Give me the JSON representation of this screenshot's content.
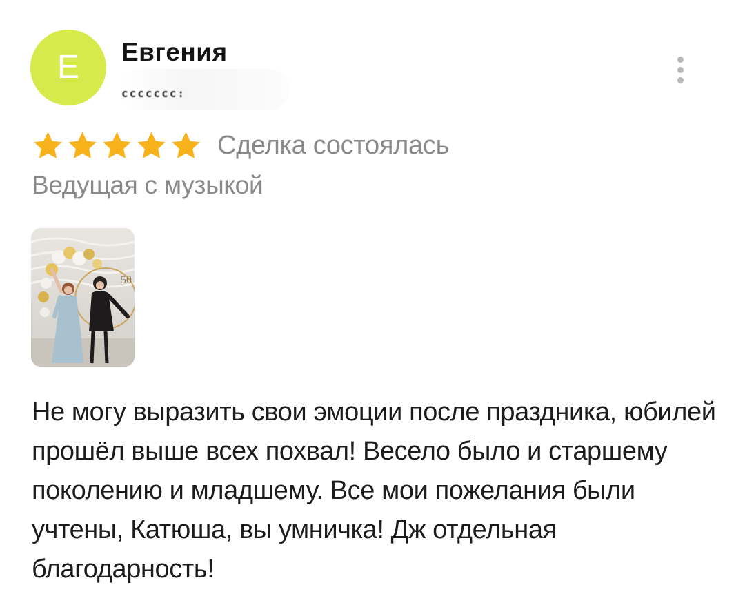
{
  "review": {
    "author": {
      "initial": "Е",
      "name": "Евгения",
      "meta_blurred": "ccccccc:"
    },
    "rating": {
      "stars": 5,
      "max_stars": 5,
      "star_color": "#f8b21c",
      "deal_status": "Сделка состоялась"
    },
    "service": "Ведущая с музыкой",
    "photo": {
      "icon": "photo-thumbnail",
      "caption_on_image": "50"
    },
    "text": "Не могу выразить свои эмоции после праздника, юбилей прошёл выше всех похвал! Весело было и старшему поколению и младшему. Все мои пожелания были учтены, Катюша, вы умничка! Дж отдельная благодарность!"
  },
  "colors": {
    "avatar_bg": "#d7ea4c",
    "secondary_text": "#8a8a8a",
    "primary_text": "#1c1c1c"
  }
}
